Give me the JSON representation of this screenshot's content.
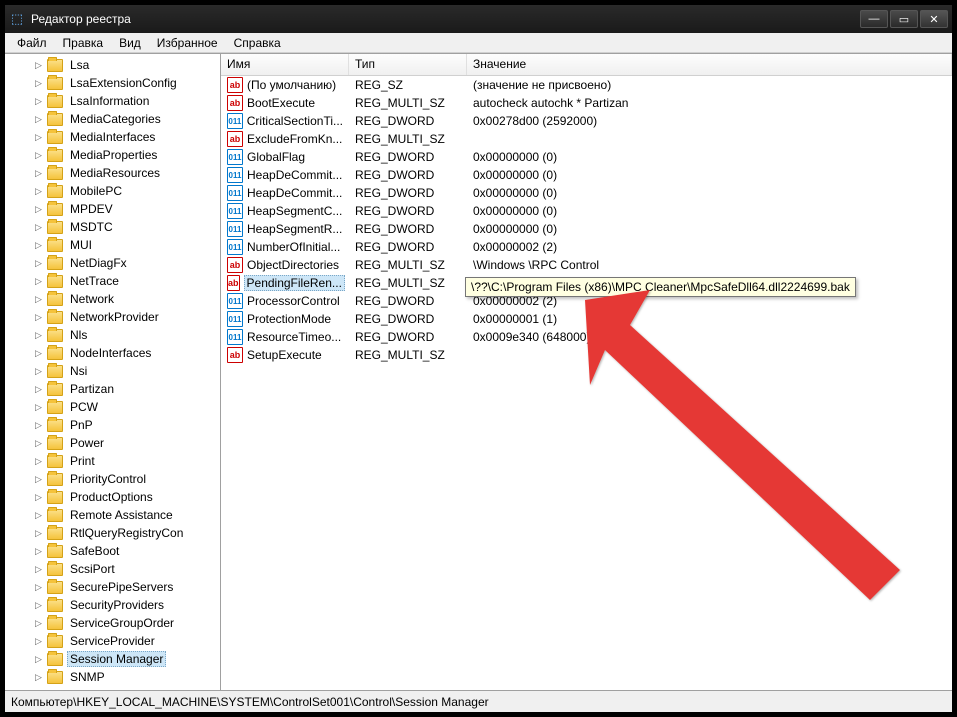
{
  "window": {
    "title": "Редактор реестра"
  },
  "menus": [
    "Файл",
    "Правка",
    "Вид",
    "Избранное",
    "Справка"
  ],
  "columns": {
    "name": "Имя",
    "type": "Тип",
    "value": "Значение"
  },
  "tree": [
    {
      "label": "Lsa"
    },
    {
      "label": "LsaExtensionConfig"
    },
    {
      "label": "LsaInformation"
    },
    {
      "label": "MediaCategories"
    },
    {
      "label": "MediaInterfaces"
    },
    {
      "label": "MediaProperties"
    },
    {
      "label": "MediaResources"
    },
    {
      "label": "MobilePC"
    },
    {
      "label": "MPDEV"
    },
    {
      "label": "MSDTC"
    },
    {
      "label": "MUI"
    },
    {
      "label": "NetDiagFx"
    },
    {
      "label": "NetTrace"
    },
    {
      "label": "Network"
    },
    {
      "label": "NetworkProvider"
    },
    {
      "label": "Nls"
    },
    {
      "label": "NodeInterfaces"
    },
    {
      "label": "Nsi"
    },
    {
      "label": "Partizan"
    },
    {
      "label": "PCW"
    },
    {
      "label": "PnP"
    },
    {
      "label": "Power"
    },
    {
      "label": "Print"
    },
    {
      "label": "PriorityControl"
    },
    {
      "label": "ProductOptions"
    },
    {
      "label": "Remote Assistance"
    },
    {
      "label": "RtlQueryRegistryCon"
    },
    {
      "label": "SafeBoot"
    },
    {
      "label": "ScsiPort"
    },
    {
      "label": "SecurePipeServers"
    },
    {
      "label": "SecurityProviders"
    },
    {
      "label": "ServiceGroupOrder"
    },
    {
      "label": "ServiceProvider"
    },
    {
      "label": "Session Manager",
      "selected": true
    },
    {
      "label": "SNMP"
    }
  ],
  "values": [
    {
      "icon": "str",
      "name": "(По умолчанию)",
      "type": "REG_SZ",
      "value": "(значение не присвоено)"
    },
    {
      "icon": "str",
      "name": "BootExecute",
      "type": "REG_MULTI_SZ",
      "value": "autocheck autochk * Partizan"
    },
    {
      "icon": "bin",
      "name": "CriticalSectionTi...",
      "type": "REG_DWORD",
      "value": "0x00278d00 (2592000)"
    },
    {
      "icon": "str",
      "name": "ExcludeFromKn...",
      "type": "REG_MULTI_SZ",
      "value": ""
    },
    {
      "icon": "bin",
      "name": "GlobalFlag",
      "type": "REG_DWORD",
      "value": "0x00000000 (0)"
    },
    {
      "icon": "bin",
      "name": "HeapDeCommit...",
      "type": "REG_DWORD",
      "value": "0x00000000 (0)"
    },
    {
      "icon": "bin",
      "name": "HeapDeCommit...",
      "type": "REG_DWORD",
      "value": "0x00000000 (0)"
    },
    {
      "icon": "bin",
      "name": "HeapSegmentC...",
      "type": "REG_DWORD",
      "value": "0x00000000 (0)"
    },
    {
      "icon": "bin",
      "name": "HeapSegmentR...",
      "type": "REG_DWORD",
      "value": "0x00000000 (0)"
    },
    {
      "icon": "bin",
      "name": "NumberOfInitial...",
      "type": "REG_DWORD",
      "value": "0x00000002 (2)"
    },
    {
      "icon": "str",
      "name": "ObjectDirectories",
      "type": "REG_MULTI_SZ",
      "value": "\\Windows \\RPC Control"
    },
    {
      "icon": "str",
      "name": "PendingFileRen...",
      "type": "REG_MULTI_SZ",
      "value": "",
      "selected": true
    },
    {
      "icon": "bin",
      "name": "ProcessorControl",
      "type": "REG_DWORD",
      "value": "0x00000002 (2)"
    },
    {
      "icon": "bin",
      "name": "ProtectionMode",
      "type": "REG_DWORD",
      "value": "0x00000001 (1)"
    },
    {
      "icon": "bin",
      "name": "ResourceTimeo...",
      "type": "REG_DWORD",
      "value": "0x0009e340 (648000)"
    },
    {
      "icon": "str",
      "name": "SetupExecute",
      "type": "REG_MULTI_SZ",
      "value": ""
    }
  ],
  "tooltip": "\\??\\C:\\Program Files (x86)\\MPC Cleaner\\MpcSafeDll64.dll2224699.bak",
  "statusbar": "Компьютер\\HKEY_LOCAL_MACHINE\\SYSTEM\\ControlSet001\\Control\\Session Manager"
}
